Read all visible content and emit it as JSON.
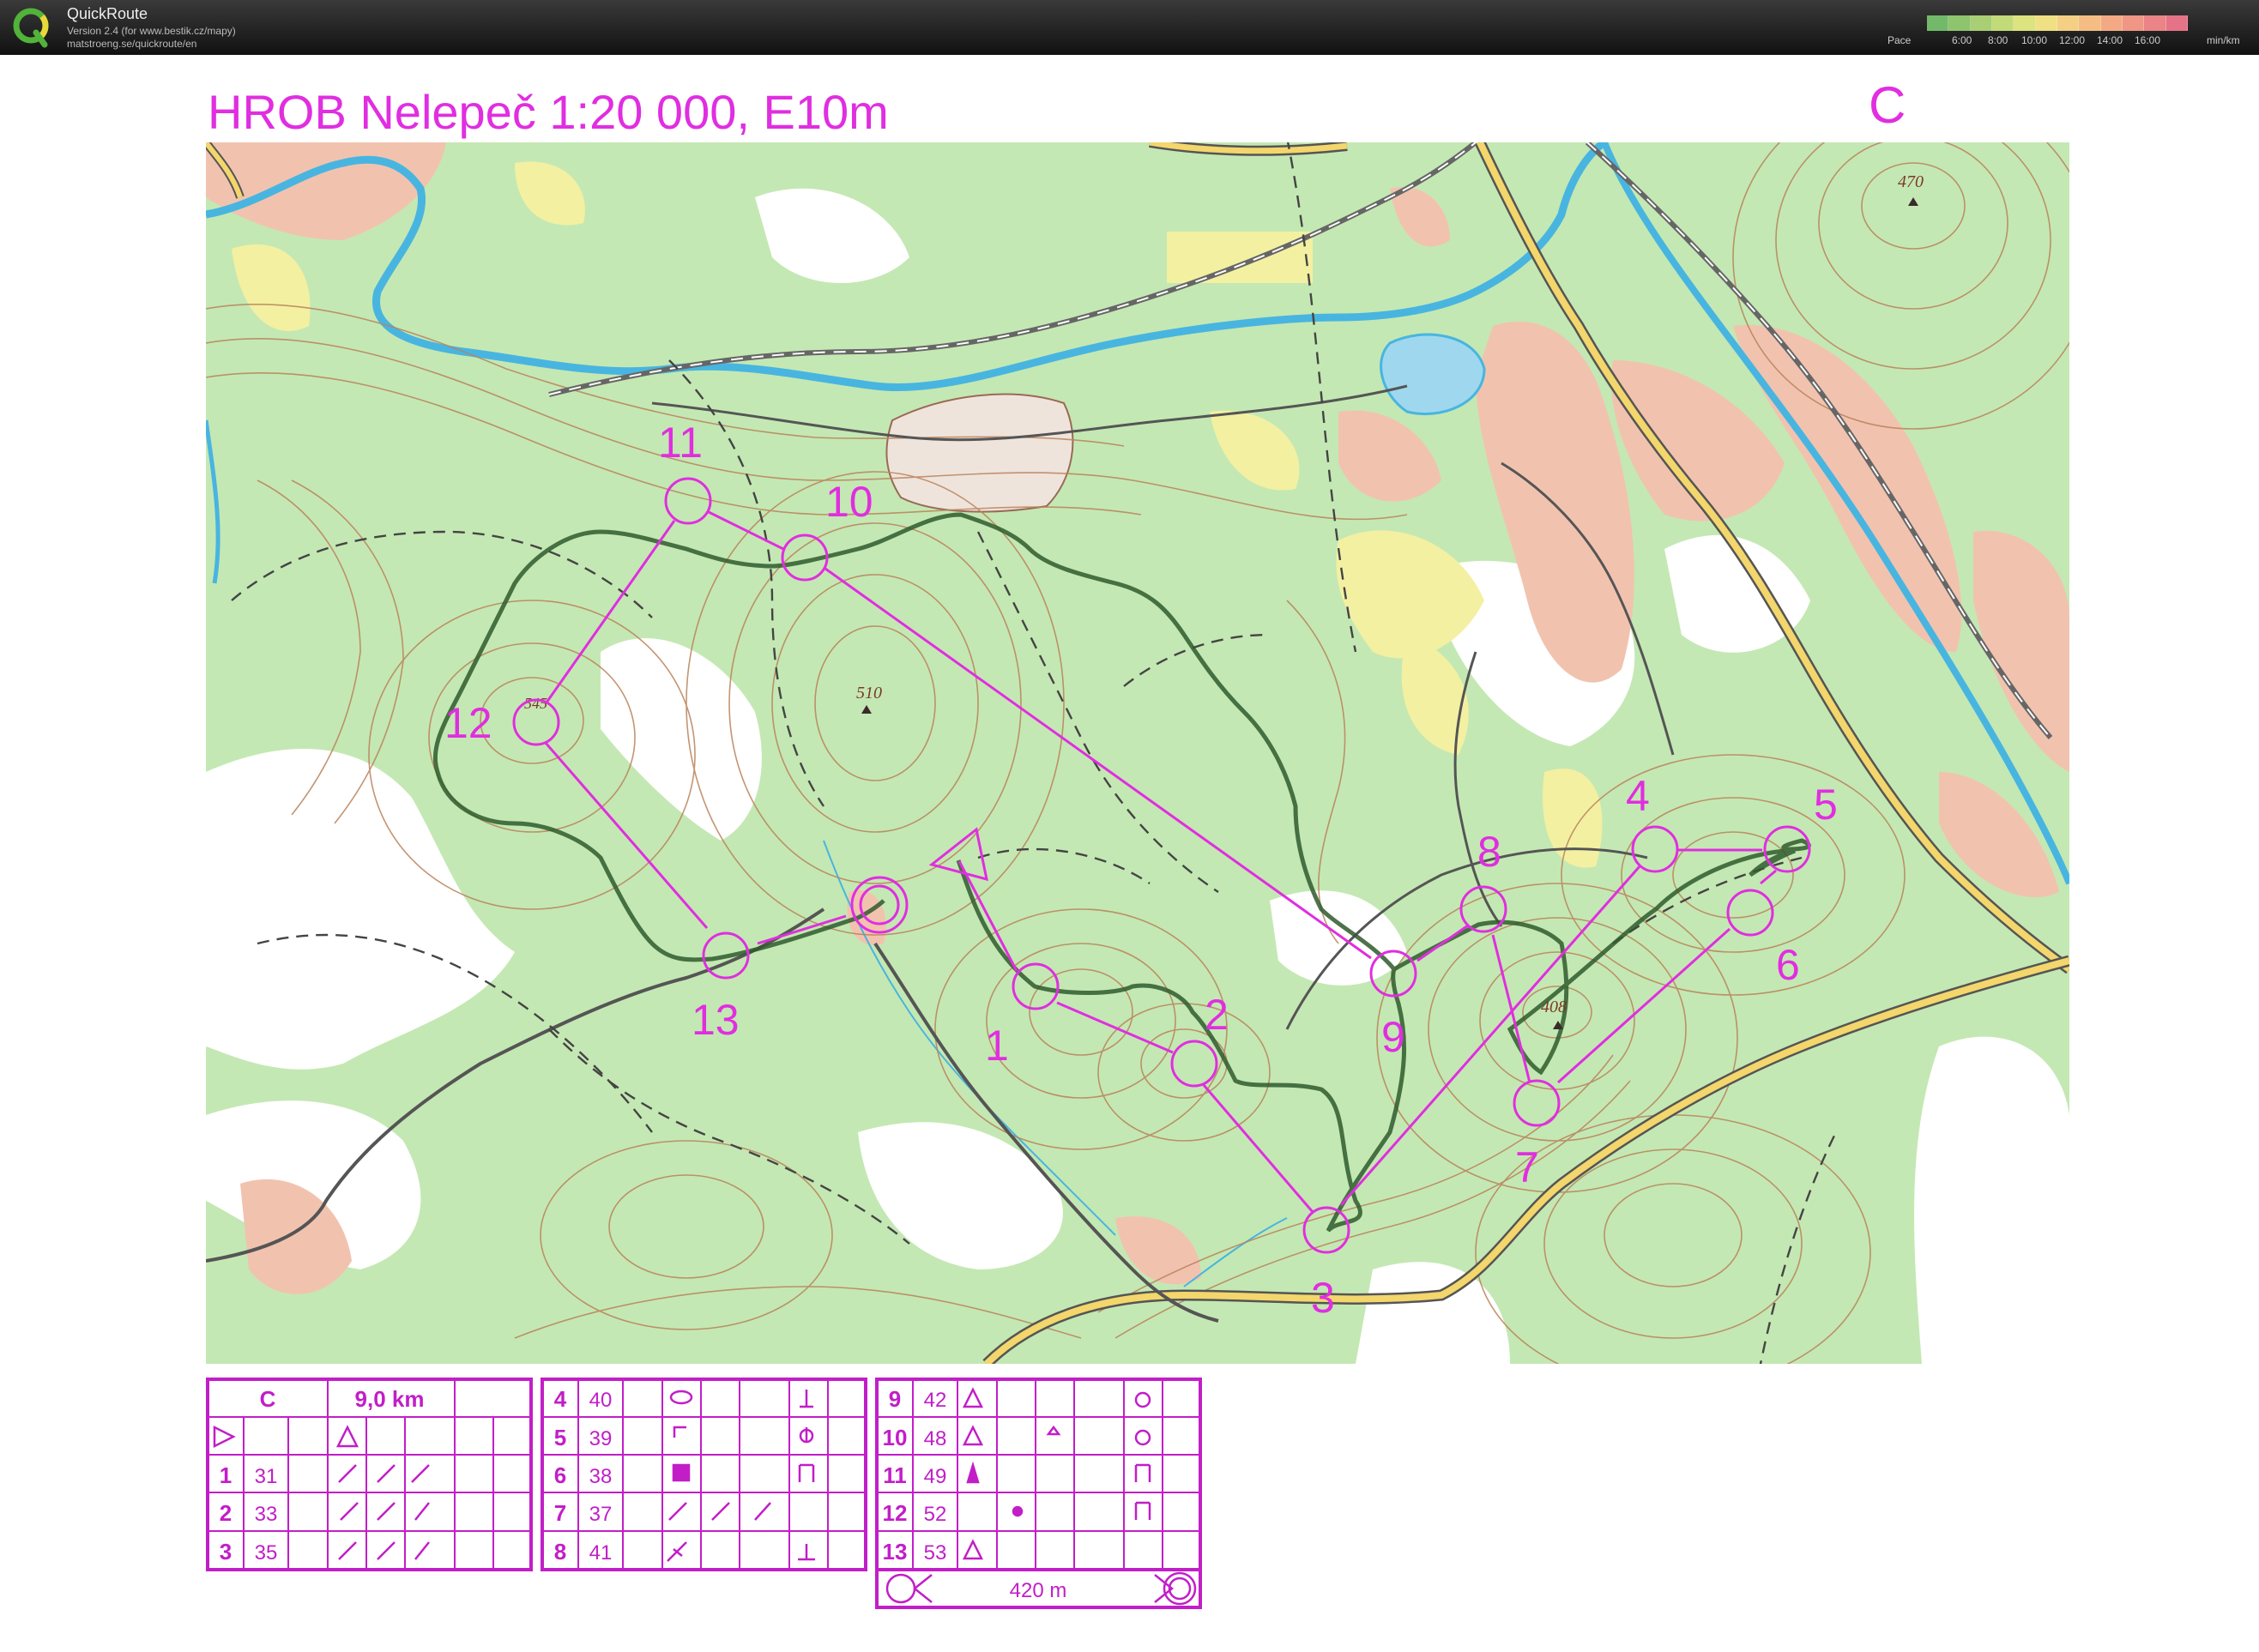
{
  "app": {
    "name": "QuickRoute",
    "version": "Version 2.4  (for www.bestik.cz/mapy)",
    "url": "matstroeng.se/quickroute/en"
  },
  "pace_legend": {
    "label": "Pace",
    "ticks": [
      "6:00",
      "8:00",
      "10:00",
      "12:00",
      "14:00",
      "16:00"
    ],
    "unit": "min/km",
    "colors": [
      "#73b96a",
      "#8fc46f",
      "#a9cf74",
      "#c3da79",
      "#dde37f",
      "#efe083",
      "#f4cf84",
      "#f5bd84",
      "#f3aa84",
      "#ef9685",
      "#ea8486",
      "#e57387"
    ]
  },
  "map": {
    "title": "HROB Nelepeč 1:20 000, E10m",
    "course": "C",
    "colors": {
      "course": "#e02ee0",
      "forest": "#bfe5ae",
      "field": "#ffffff",
      "contour": "#b9835b",
      "water": "#49b7e2",
      "road": "#f1d46b",
      "settlement": "#f2c2b0"
    },
    "spot_heights": [
      "470",
      "510",
      "545",
      "408"
    ],
    "controls": [
      {
        "label": "1"
      },
      {
        "label": "2"
      },
      {
        "label": "3"
      },
      {
        "label": "4"
      },
      {
        "label": "5"
      },
      {
        "label": "6"
      },
      {
        "label": "7"
      },
      {
        "label": "8"
      },
      {
        "label": "9"
      },
      {
        "label": "10"
      },
      {
        "label": "11"
      },
      {
        "label": "12"
      },
      {
        "label": "13"
      }
    ]
  },
  "description_sheet": {
    "course": "C",
    "length": "9,0 km",
    "finish_distance": "420 m",
    "controls": [
      {
        "n": "1",
        "code": "31"
      },
      {
        "n": "2",
        "code": "33"
      },
      {
        "n": "3",
        "code": "35"
      },
      {
        "n": "4",
        "code": "40"
      },
      {
        "n": "5",
        "code": "39"
      },
      {
        "n": "6",
        "code": "38"
      },
      {
        "n": "7",
        "code": "37"
      },
      {
        "n": "8",
        "code": "41"
      },
      {
        "n": "9",
        "code": "42"
      },
      {
        "n": "10",
        "code": "48"
      },
      {
        "n": "11",
        "code": "49"
      },
      {
        "n": "12",
        "code": "52"
      },
      {
        "n": "13",
        "code": "53"
      }
    ]
  }
}
